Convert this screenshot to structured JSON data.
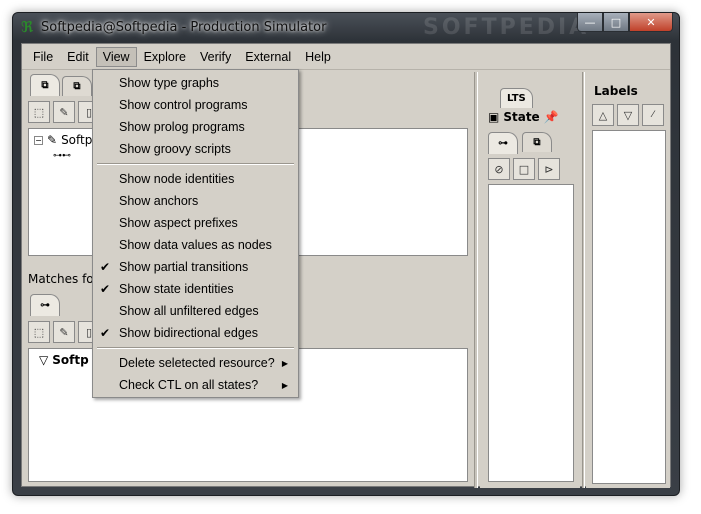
{
  "window": {
    "title": "Softpedia@Softpedia - Production Simulator",
    "watermark": "SOFTPEDIA",
    "controls": {
      "minimize": "—",
      "maximize": "□",
      "close": "✕"
    }
  },
  "menubar": [
    "File",
    "Edit",
    "View",
    "Explore",
    "Verify",
    "External",
    "Help"
  ],
  "view_menu": {
    "group1": [
      "Show type graphs",
      "Show control programs",
      "Show prolog programs",
      "Show groovy scripts"
    ],
    "group2": [
      {
        "label": "Show node identities",
        "checked": false
      },
      {
        "label": "Show anchors",
        "checked": false
      },
      {
        "label": "Show aspect prefixes",
        "checked": false
      },
      {
        "label": "Show data values as nodes",
        "checked": false
      },
      {
        "label": "Show partial transitions",
        "checked": true
      },
      {
        "label": "Show state identities",
        "checked": true
      },
      {
        "label": "Show all unfiltered edges",
        "checked": false
      },
      {
        "label": "Show bidirectional edges",
        "checked": true
      }
    ],
    "group3": [
      {
        "label": "Delete seletected resource?",
        "submenu": true
      },
      {
        "label": "Check CTL on all states?",
        "submenu": true
      }
    ]
  },
  "left_top": {
    "tree_root": "Softp"
  },
  "left_bottom": {
    "status": "Matches for s",
    "tree_root": "Softp"
  },
  "right": {
    "lts_tab": "LTS",
    "state_tab": "State",
    "labels_title": "Labels"
  }
}
